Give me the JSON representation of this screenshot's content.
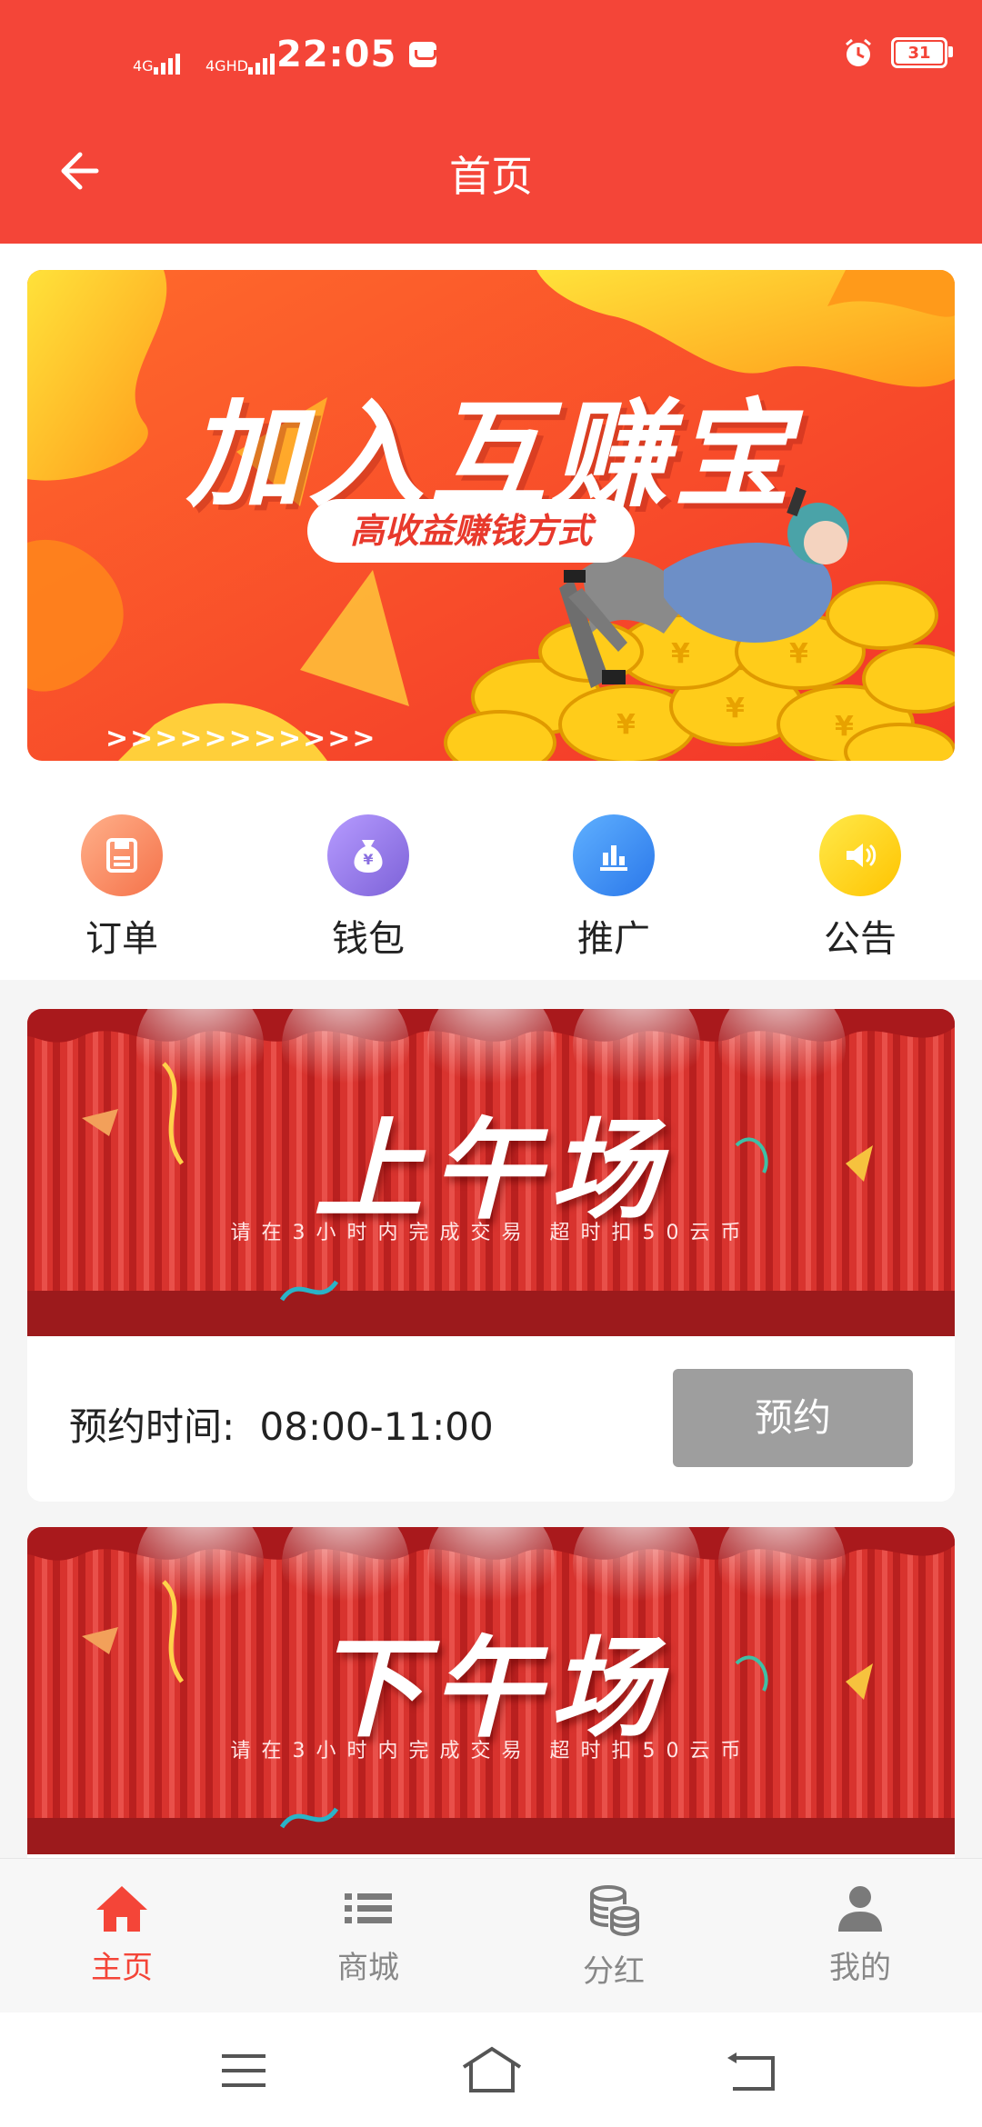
{
  "status_bar": {
    "signal1": "4G",
    "signal2": "4GHD",
    "time": "22:05",
    "battery": "31"
  },
  "nav": {
    "title": "首页"
  },
  "banner": {
    "title": "加入互赚宝",
    "pill": "高收益赚钱方式",
    "arrows": ">>>>>>>>>>>"
  },
  "menu": [
    {
      "label": "订单",
      "icon": "order-icon",
      "color": "#f47f5a"
    },
    {
      "label": "钱包",
      "icon": "wallet-icon",
      "color": "#9a7fe6"
    },
    {
      "label": "推广",
      "icon": "promote-icon",
      "color": "#3d8ef4"
    },
    {
      "label": "公告",
      "icon": "announcement-icon",
      "color": "#ffd400"
    }
  ],
  "sessions": [
    {
      "title": "上午场",
      "subtitle": "请在3小时内完成交易 超时扣50云币",
      "time_label": "预约时间:",
      "time_value": "08:00-11:00",
      "button": "预约"
    },
    {
      "title": "下午场",
      "subtitle": "请在3小时内完成交易 超时扣50云币"
    }
  ],
  "tabbar": [
    {
      "label": "主页",
      "icon": "home-icon",
      "active": true
    },
    {
      "label": "商城",
      "icon": "list-icon",
      "active": false
    },
    {
      "label": "分红",
      "icon": "coins-icon",
      "active": false
    },
    {
      "label": "我的",
      "icon": "profile-icon",
      "active": false
    }
  ],
  "colors": {
    "brand": "#f44538",
    "button_disabled": "#9e9e9e"
  }
}
